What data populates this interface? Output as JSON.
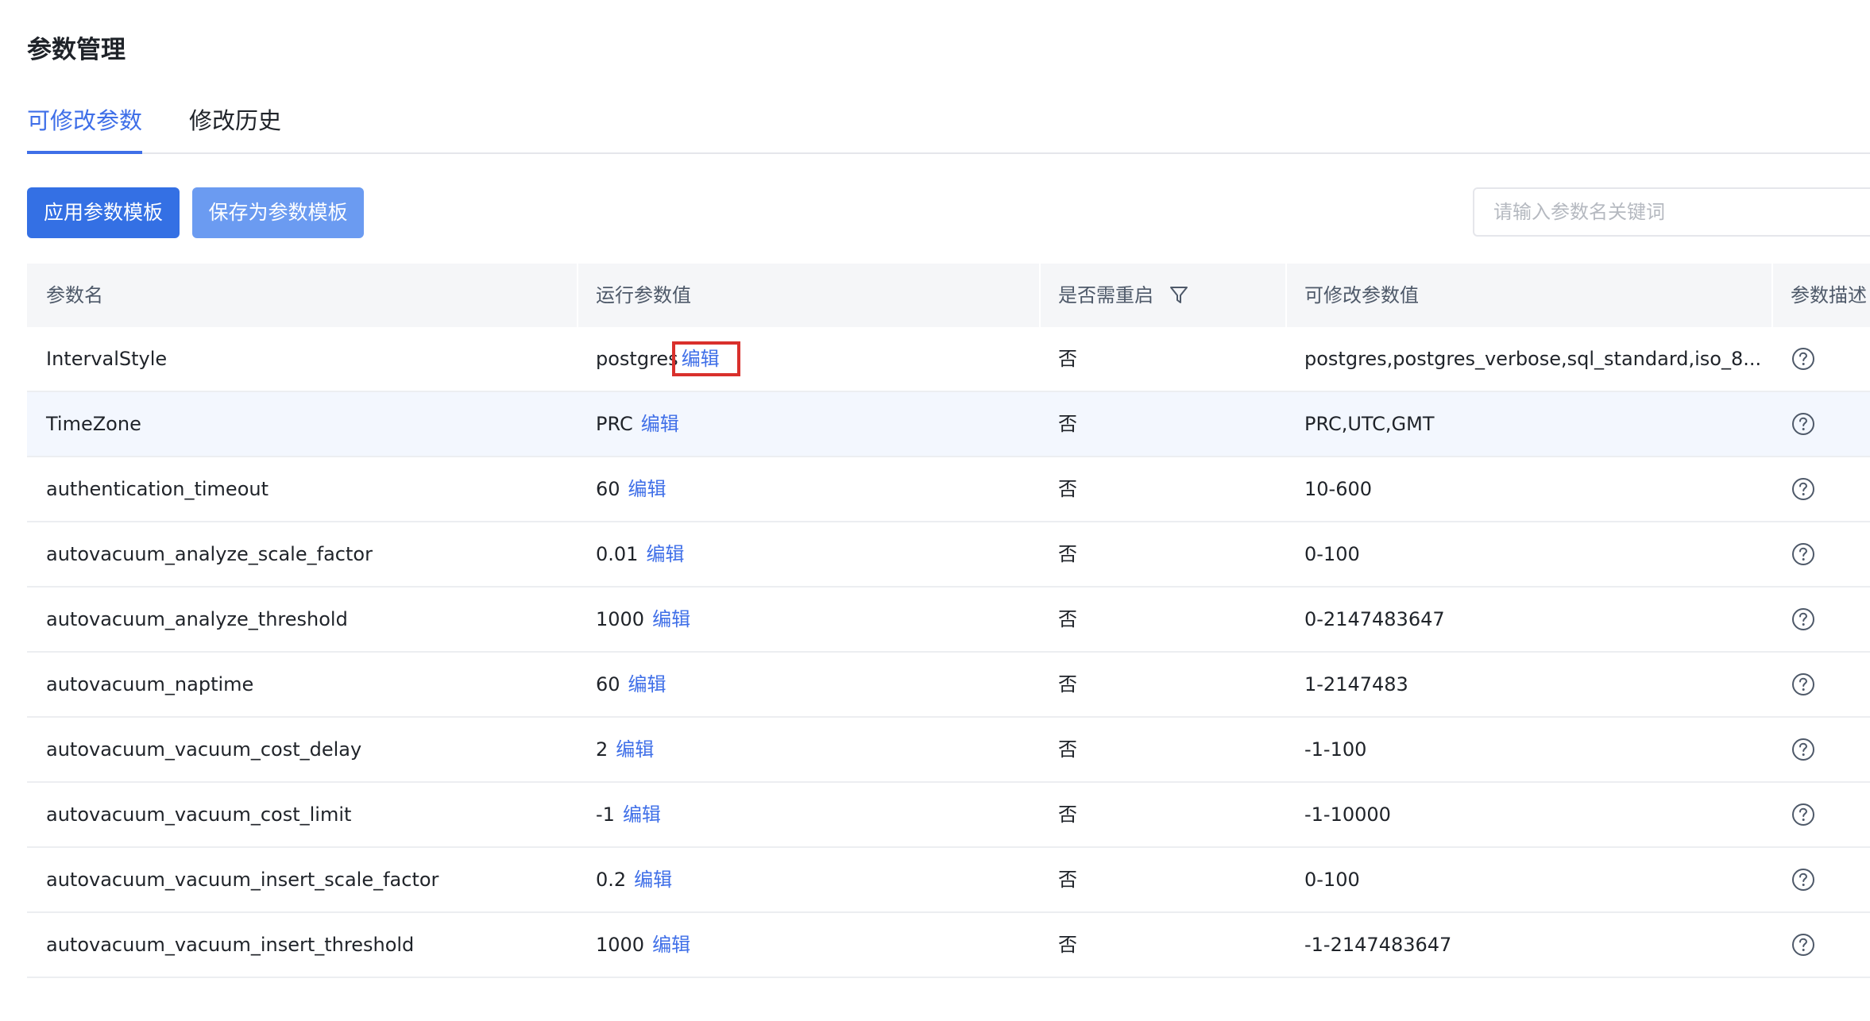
{
  "page": {
    "title": "参数管理"
  },
  "tabs": [
    {
      "label": "可修改参数",
      "active": true
    },
    {
      "label": "修改历史",
      "active": false
    }
  ],
  "toolbar": {
    "apply_template_label": "应用参数模板",
    "save_template_label": "保存为参数模板",
    "search_placeholder": "请输入参数名关键词"
  },
  "table": {
    "columns": [
      "参数名",
      "运行参数值",
      "是否需重启",
      "可修改参数值",
      "参数描述"
    ],
    "edit_label": "编辑",
    "rows": [
      {
        "name": "IntervalStyle",
        "value": "postgres",
        "restart": "否",
        "allowed": "postgres,postgres_verbose,sql_standard,iso_8...",
        "highlighted_edit": true
      },
      {
        "name": "TimeZone",
        "value": "PRC",
        "restart": "否",
        "allowed": "PRC,UTC,GMT",
        "row_hover": true
      },
      {
        "name": "authentication_timeout",
        "value": "60",
        "restart": "否",
        "allowed": "10-600"
      },
      {
        "name": "autovacuum_analyze_scale_factor",
        "value": "0.01",
        "restart": "否",
        "allowed": "0-100"
      },
      {
        "name": "autovacuum_analyze_threshold",
        "value": "1000",
        "restart": "否",
        "allowed": "0-2147483647"
      },
      {
        "name": "autovacuum_naptime",
        "value": "60",
        "restart": "否",
        "allowed": "1-2147483"
      },
      {
        "name": "autovacuum_vacuum_cost_delay",
        "value": "2",
        "restart": "否",
        "allowed": "-1-100"
      },
      {
        "name": "autovacuum_vacuum_cost_limit",
        "value": "-1",
        "restart": "否",
        "allowed": "-1-10000"
      },
      {
        "name": "autovacuum_vacuum_insert_scale_factor",
        "value": "0.2",
        "restart": "否",
        "allowed": "0-100"
      },
      {
        "name": "autovacuum_vacuum_insert_threshold",
        "value": "1000",
        "restart": "否",
        "allowed": "-1-2147483647"
      }
    ]
  },
  "colors": {
    "accent": "#3f6fe8",
    "primary_button": "#3470e4",
    "secondary_button": "#6b9bf1",
    "highlight_box": "#d9302c",
    "row_hover": "#f3f7fe"
  }
}
